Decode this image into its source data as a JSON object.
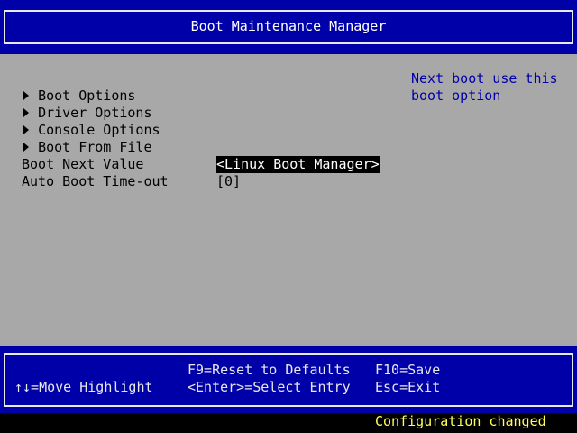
{
  "header": {
    "title": "Boot Maintenance Manager"
  },
  "menu": {
    "items": [
      {
        "label": "Boot Options"
      },
      {
        "label": "Driver Options"
      },
      {
        "label": "Console Options"
      },
      {
        "label": "Boot From File"
      }
    ]
  },
  "settings": {
    "boot_next": {
      "label": "Boot Next Value",
      "value": "<Linux Boot Manager>"
    },
    "auto_boot_timeout": {
      "label": "Auto Boot Time-out",
      "value": "[0]"
    }
  },
  "help": {
    "line1": "Next boot use this",
    "line2": "boot option"
  },
  "footer": {
    "move_highlight": "↑↓=Move Highlight",
    "reset_defaults": "F9=Reset to Defaults",
    "select_entry": "<Enter>=Select Entry",
    "save": "F10=Save",
    "exit": "Esc=Exit"
  },
  "status": {
    "message": "Configuration changed"
  },
  "colors": {
    "background_blue": "#0000a8",
    "panel_grey": "#a8a8a8",
    "help_text": "#0000a8",
    "status_text": "#ffff55"
  }
}
